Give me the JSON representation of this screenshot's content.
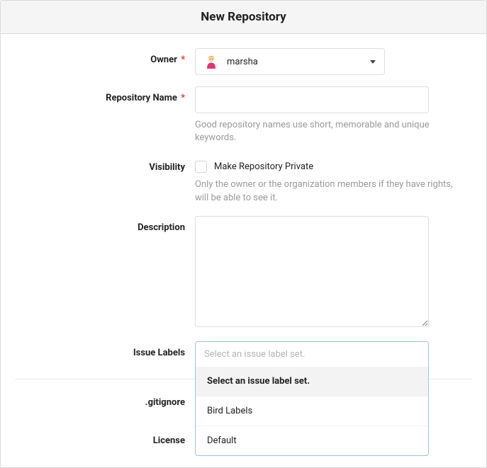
{
  "header": {
    "title": "New Repository"
  },
  "owner": {
    "label": "Owner",
    "required": "*",
    "value": "marsha"
  },
  "repo_name": {
    "label": "Repository Name",
    "required": "*",
    "value": "",
    "help": "Good repository names use short, memorable and unique keywords."
  },
  "visibility": {
    "label": "Visibility",
    "checkbox_label": "Make Repository Private",
    "help": "Only the owner or the organization members if they have rights, will be able to see it."
  },
  "description": {
    "label": "Description",
    "value": ""
  },
  "issue_labels": {
    "label": "Issue Labels",
    "placeholder": "Select an issue label set.",
    "options": [
      "Select an issue label set.",
      "Bird Labels",
      "Default"
    ]
  },
  "gitignore": {
    "label": ".gitignore"
  },
  "license": {
    "label": "License"
  }
}
